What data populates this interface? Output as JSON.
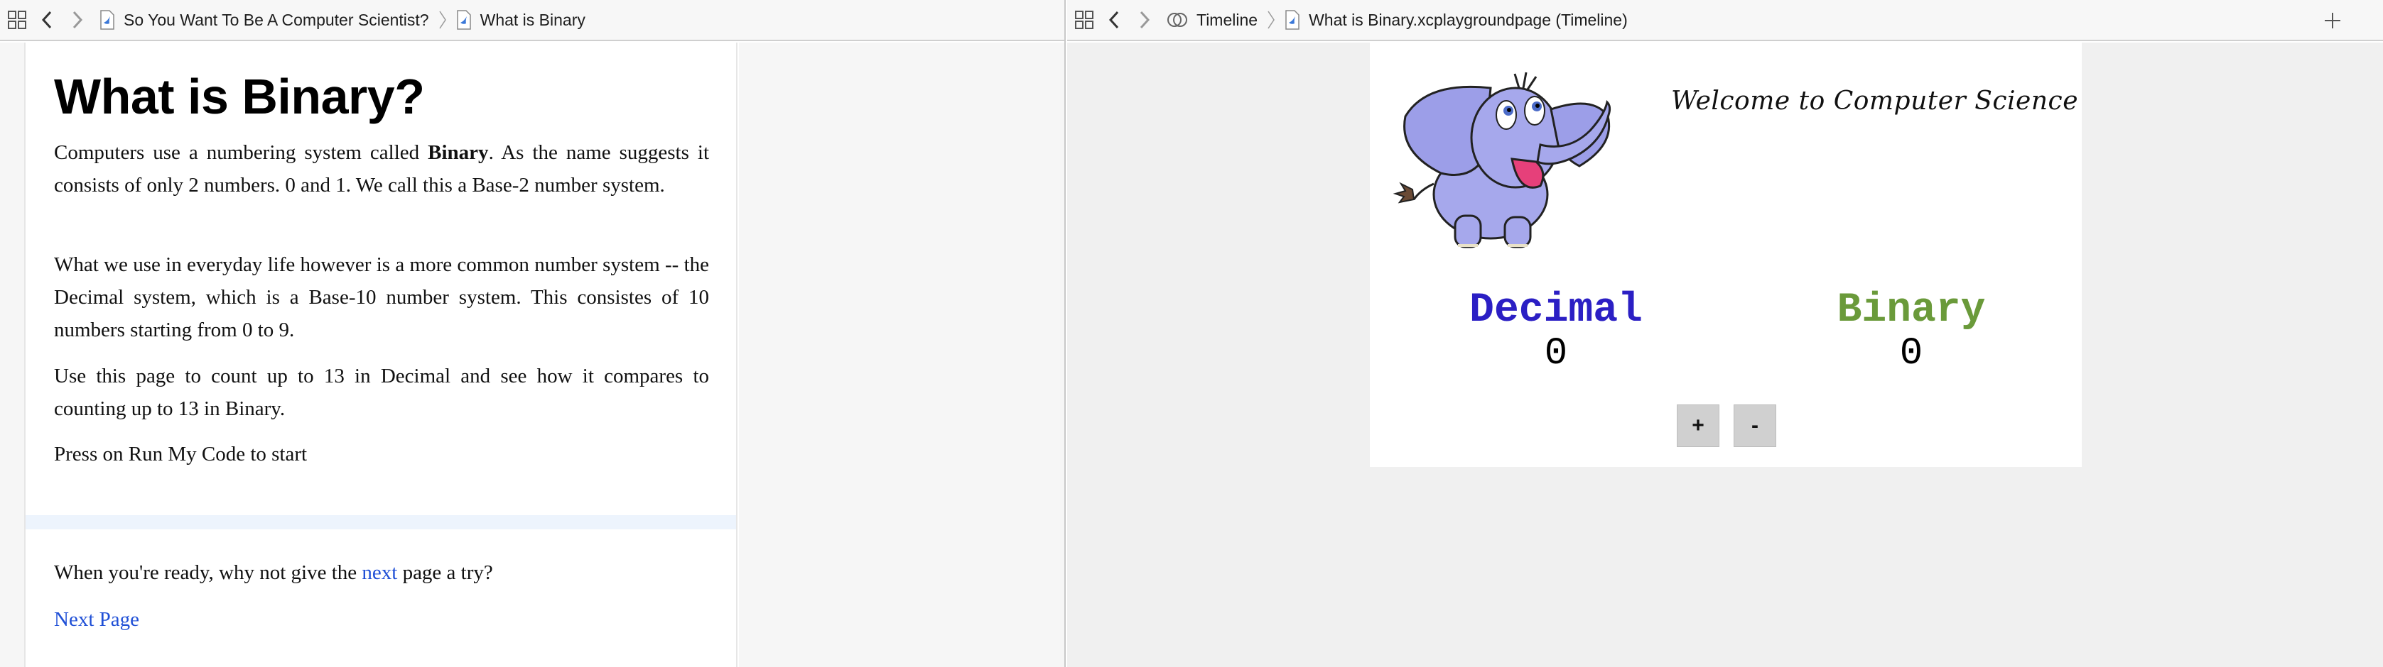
{
  "left": {
    "jumpbar": {
      "crumbs": [
        "So You Want To Be A Computer Scientist?",
        "What is Binary"
      ]
    },
    "doc": {
      "title": "What is Binary?",
      "p1_before": "Computers use a numbering system called ",
      "p1_bold": "Binary",
      "p1_after": ". As the name suggests it consists of only 2 numbers. 0 and 1. We call this a Base-2 number system.",
      "p2": "What we use in everyday life however is a more common number system -- the Decimal system, which is a Base-10 number system. This consistes of 10 numbers starting from 0 to 9.",
      "p3": "Use this page to count up to 13 in Decimal and see how it compares to counting up to 13 in Binary.",
      "p4": "Press on Run My Code to start",
      "p5_before": "When you're ready, why not give the ",
      "p5_link": "next",
      "p5_after": " page a try?",
      "next_page_link": "Next Page"
    }
  },
  "right": {
    "jumpbar": {
      "crumbs": [
        "Timeline",
        "What is Binary.xcplaygroundpage (Timeline)"
      ]
    },
    "live": {
      "welcome": "Welcome to Computer Science",
      "decimal_label": "Decimal",
      "decimal_value": "0",
      "binary_label": "Binary",
      "binary_value": "0",
      "plus_label": "+",
      "minus_label": "-"
    }
  },
  "icons": {
    "grid": "grid-icon",
    "back": "chevron-left-icon",
    "forward": "chevron-right-icon",
    "file": "swift-file-icon",
    "timeline": "timeline-icon",
    "add": "plus-icon"
  },
  "colors": {
    "decimal": "#2b1fc4",
    "binary": "#6a9a3a",
    "link": "#1f4fd6",
    "elephant": "#a6a8ec"
  }
}
